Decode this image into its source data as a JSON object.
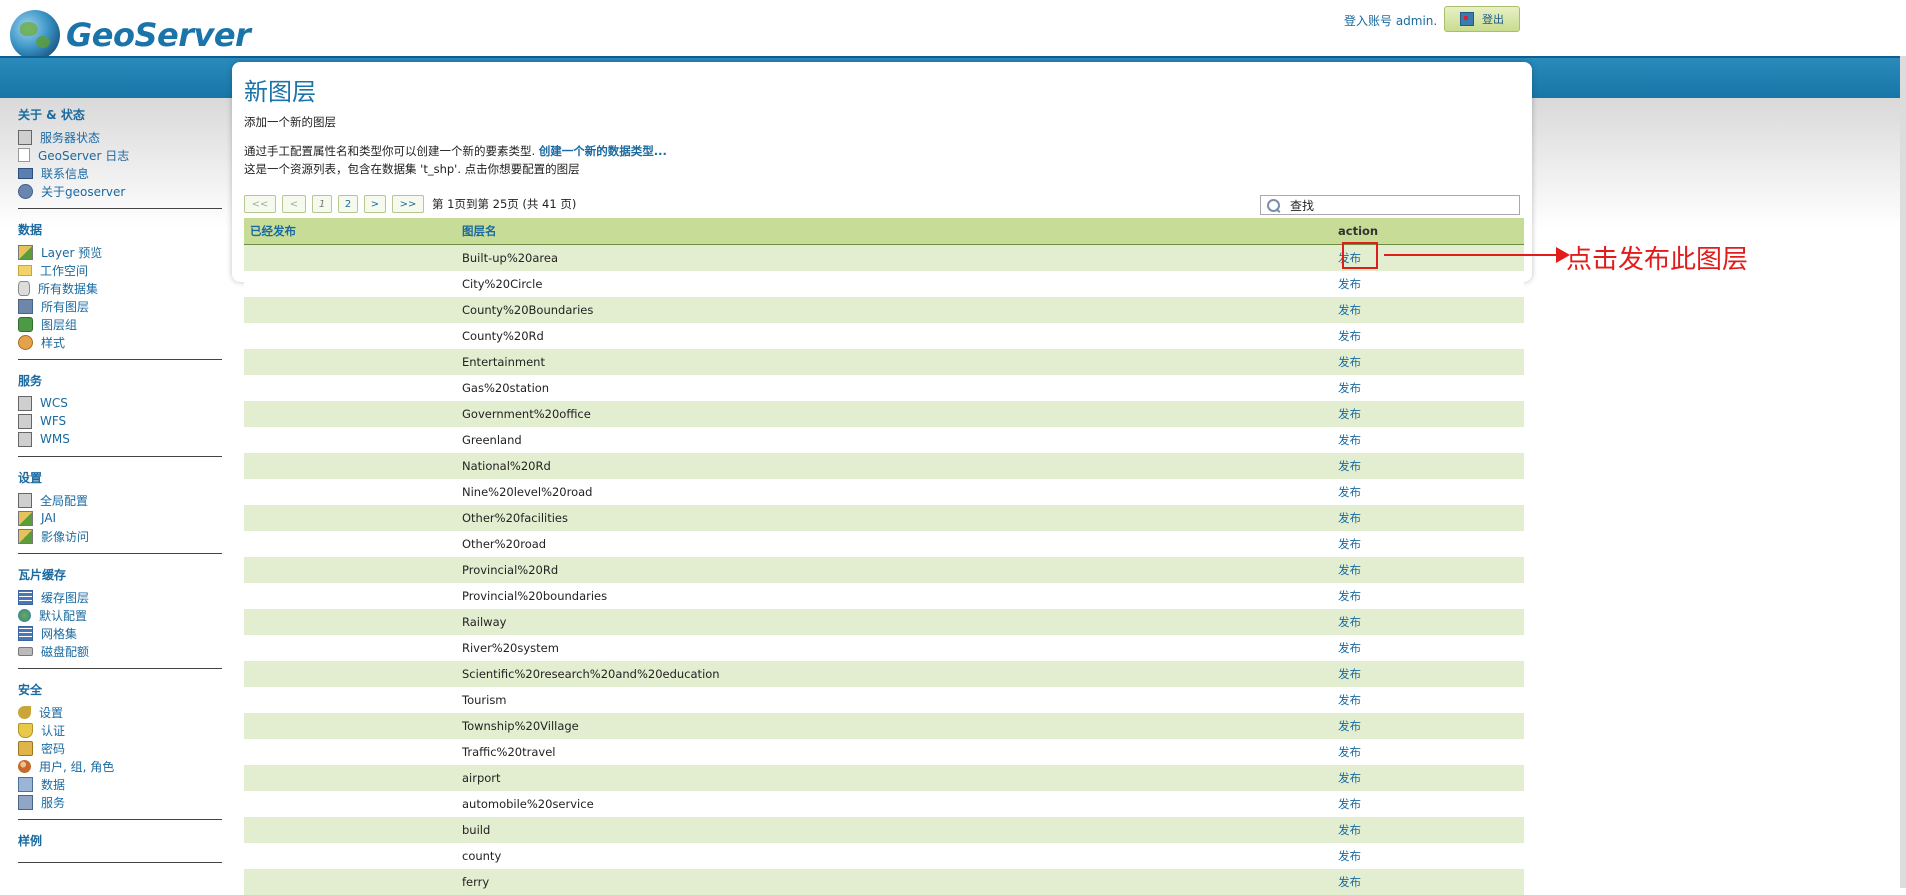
{
  "header": {
    "brand": "GeoServer",
    "login_text": "登入账号 admin.",
    "logout_label": "登出"
  },
  "sidebar": {
    "sections": [
      {
        "title": "关于 & 状态",
        "items": [
          {
            "label": "服务器状态",
            "icon": "server-status-icon"
          },
          {
            "label": "GeoServer 日志",
            "icon": "log-icon"
          },
          {
            "label": "联系信息",
            "icon": "contact-icon"
          },
          {
            "label": "关于geoserver",
            "icon": "info-icon"
          }
        ]
      },
      {
        "title": "数据",
        "items": [
          {
            "label": "Layer 预览",
            "icon": "map-icon"
          },
          {
            "label": "工作空间",
            "icon": "folder-icon"
          },
          {
            "label": "所有数据集",
            "icon": "database-icon"
          },
          {
            "label": "所有图层",
            "icon": "layers-icon"
          },
          {
            "label": "图层组",
            "icon": "layer-group-icon"
          },
          {
            "label": "样式",
            "icon": "palette-icon"
          }
        ]
      },
      {
        "title": "服务",
        "items": [
          {
            "label": "WCS",
            "icon": "server-icon"
          },
          {
            "label": "WFS",
            "icon": "server-icon"
          },
          {
            "label": "WMS",
            "icon": "server-icon"
          }
        ]
      },
      {
        "title": "设置",
        "items": [
          {
            "label": "全局配置",
            "icon": "server-icon"
          },
          {
            "label": "JAI",
            "icon": "map-icon"
          },
          {
            "label": "影像访问",
            "icon": "map-icon"
          }
        ]
      },
      {
        "title": "瓦片缓存",
        "items": [
          {
            "label": "缓存图层",
            "icon": "grid-icon"
          },
          {
            "label": "默认配置",
            "icon": "globe-icon"
          },
          {
            "label": "网格集",
            "icon": "grid-icon"
          },
          {
            "label": "磁盘配额",
            "icon": "disk-icon"
          }
        ]
      },
      {
        "title": "安全",
        "items": [
          {
            "label": "设置",
            "icon": "key-icon"
          },
          {
            "label": "认证",
            "icon": "shield-icon"
          },
          {
            "label": "密码",
            "icon": "lock-icon"
          },
          {
            "label": "用户, 组, 角色",
            "icon": "users-icon"
          },
          {
            "label": "数据",
            "icon": "data-icon"
          },
          {
            "label": "服务",
            "icon": "service-icon"
          }
        ]
      },
      {
        "title": "样例",
        "items": []
      }
    ]
  },
  "main": {
    "title": "新图层",
    "subtitle": "添加一个新的图层",
    "desc1_prefix": "通过手工配置属性名和类型你可以创建一个新的要素类型.",
    "desc1_link": "创建一个新的数据类型...",
    "desc2": "这是一个资源列表，包含在数据集 't_shp'. 点击你想要配置的图层",
    "pager": {
      "first": "<<",
      "prev": "<",
      "page1": "1",
      "page2": "2",
      "next": ">",
      "last": ">>",
      "info": "第 1页到第 25页 (共 41 页)"
    },
    "search_value": "查找",
    "columns": [
      "已经发布",
      "图层名",
      "action"
    ],
    "action_label": "发布",
    "rows": [
      {
        "published": "",
        "name": "Built-up%20area"
      },
      {
        "published": "",
        "name": "City%20Circle"
      },
      {
        "published": "",
        "name": "County%20Boundaries"
      },
      {
        "published": "",
        "name": "County%20Rd"
      },
      {
        "published": "",
        "name": "Entertainment"
      },
      {
        "published": "",
        "name": "Gas%20station"
      },
      {
        "published": "",
        "name": "Government%20office"
      },
      {
        "published": "",
        "name": "Greenland"
      },
      {
        "published": "",
        "name": "National%20Rd"
      },
      {
        "published": "",
        "name": "Nine%20level%20road"
      },
      {
        "published": "",
        "name": "Other%20facilities"
      },
      {
        "published": "",
        "name": "Other%20road"
      },
      {
        "published": "",
        "name": "Provincial%20Rd"
      },
      {
        "published": "",
        "name": "Provincial%20boundaries"
      },
      {
        "published": "",
        "name": "Railway"
      },
      {
        "published": "",
        "name": "River%20system"
      },
      {
        "published": "",
        "name": "Scientific%20research%20and%20education"
      },
      {
        "published": "",
        "name": "Tourism"
      },
      {
        "published": "",
        "name": "Township%20Village"
      },
      {
        "published": "",
        "name": "Traffic%20travel"
      },
      {
        "published": "",
        "name": "airport"
      },
      {
        "published": "",
        "name": "automobile%20service"
      },
      {
        "published": "",
        "name": "build"
      },
      {
        "published": "",
        "name": "county"
      },
      {
        "published": "",
        "name": "ferry"
      }
    ]
  },
  "annotation": {
    "text": "点击发布此图层",
    "color": "#e21b1b"
  },
  "colors": {
    "brand_blue": "#1a74a9",
    "header_green": "#c7dd97",
    "row_green": "#e3eed0"
  }
}
